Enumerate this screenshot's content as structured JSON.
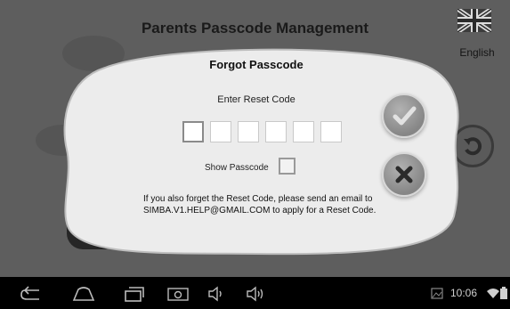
{
  "background": {
    "title": "Parents Passcode Management",
    "language_label": "English"
  },
  "dialog": {
    "title": "Forgot Passcode",
    "reset_code_label": "Enter Reset Code",
    "code_fields": [
      "",
      "",
      "",
      "",
      "",
      ""
    ],
    "show_passcode_label": "Show Passcode",
    "show_passcode_checked": false,
    "help_text": "If you also forget the Reset Code, please send an email to SIMBA.V1.HELP@GMAIL.COM to apply for a Reset Code."
  },
  "status_bar": {
    "time": "10:06"
  },
  "icons": {
    "flag": "uk-flag-icon",
    "back_background": "undo-icon",
    "confirm": "checkmark-icon",
    "cancel": "close-icon",
    "nav": [
      "back-icon",
      "home-icon",
      "recent-apps-icon",
      "screenshot-icon",
      "volume-down-icon",
      "volume-up-icon"
    ],
    "status": [
      "gallery-icon",
      "wifi-icon",
      "battery-icon"
    ]
  }
}
